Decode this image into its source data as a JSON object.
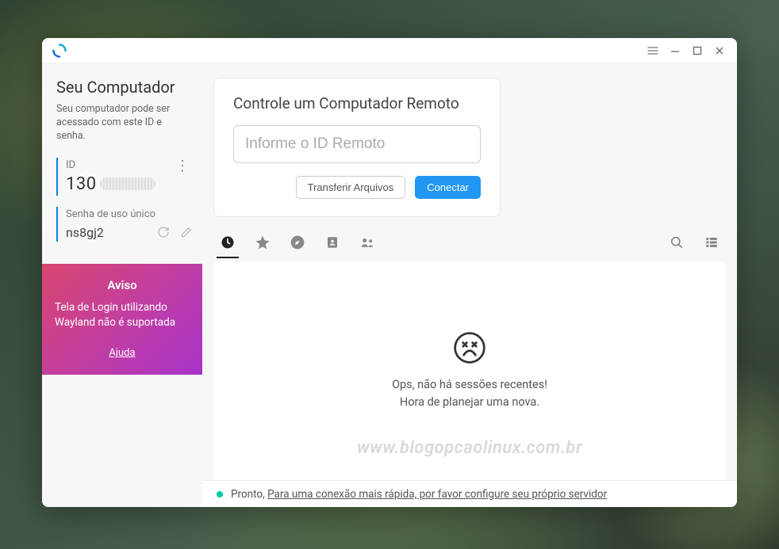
{
  "sidebar": {
    "title": "Seu Computador",
    "description": "Seu computador pode ser acessado com este ID e senha.",
    "id_label": "ID",
    "id_value": "130",
    "password_label": "Senha de uso único",
    "password_value": "ns8gj2"
  },
  "notice": {
    "title": "Aviso",
    "body": "Tela de Login utilizando Wayland não é suportada",
    "help_label": "Ajuda"
  },
  "connect": {
    "title": "Controle um Computador Remoto",
    "placeholder": "Informe o ID Remoto",
    "transfer_label": "Transferir Arquivos",
    "connect_label": "Conectar"
  },
  "tabs": {
    "recent": "recent",
    "favorites": "favorites",
    "discover": "discover",
    "addressbook": "addressbook",
    "lan": "lan"
  },
  "empty": {
    "line1": "Ops, não há sessões recentes!",
    "line2": "Hora de planejar uma nova."
  },
  "status": {
    "ready_label": "Pronto, ",
    "link_text": "Para uma conexão mais rápida, por favor configure seu próprio servidor"
  },
  "watermark": "www.blogopcaolinux.com.br",
  "colors": {
    "accent": "#2196f3",
    "sidebar_accent": "#0a84d0",
    "status_ok": "#00c9a7"
  }
}
